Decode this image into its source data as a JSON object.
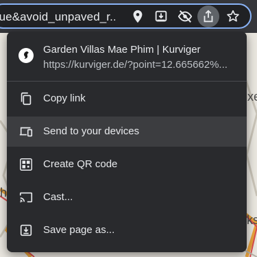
{
  "browser": {
    "url": "true&avoid_unpaved_r...",
    "icons": [
      "location-pin-icon",
      "install-app-icon",
      "tracking-protection-icon",
      "share-icon",
      "bookmark-star-icon"
    ]
  },
  "map": {
    "labels": [
      "xe",
      "h",
      "ks"
    ]
  },
  "share_menu": {
    "title": "Garden Villas Mae Phim | Kurviger",
    "url": "https://kurviger.de/?point=12.665662%...",
    "items": [
      {
        "label": "Copy link",
        "icon": "copy-icon"
      },
      {
        "label": "Send to your devices",
        "icon": "devices-icon"
      },
      {
        "label": "Create QR code",
        "icon": "qr-code-icon"
      },
      {
        "label": "Cast...",
        "icon": "cast-icon"
      },
      {
        "label": "Save page as...",
        "icon": "save-page-icon"
      }
    ]
  },
  "colors": {
    "menu_bg": "#292a2d",
    "toolbar_bg": "#35363a",
    "omnibox_border": "#8ab4f8",
    "highlight": "#3c3d40"
  }
}
